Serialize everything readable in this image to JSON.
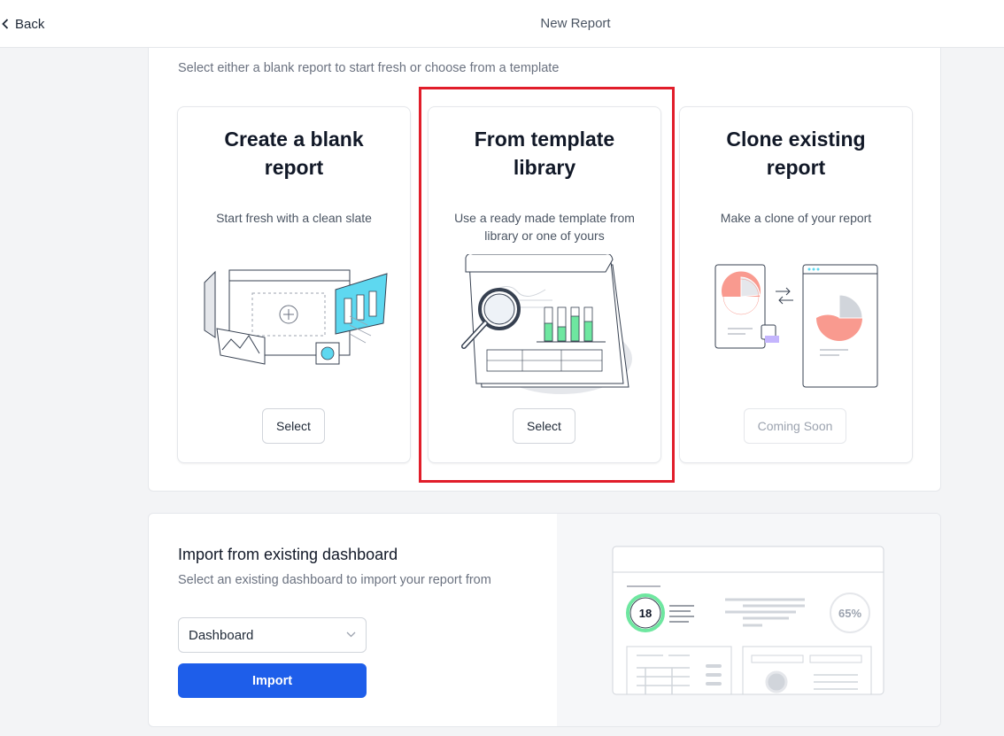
{
  "header": {
    "back_label": "Back",
    "title": "New Report"
  },
  "section": {
    "subtitle": "Select either a blank report to start fresh or choose from a template"
  },
  "cards": [
    {
      "title": "Create a blank report",
      "description": "Start fresh with a clean slate",
      "button": "Select"
    },
    {
      "title": "From template library",
      "description": "Use a ready made template from library or one of yours",
      "button": "Select"
    },
    {
      "title": "Clone existing report",
      "description": "Make a clone of your report",
      "button": "Coming Soon"
    }
  ],
  "import": {
    "title": "Import from existing dashboard",
    "subtitle": "Select an existing dashboard to import your report from",
    "dropdown_value": "Dashboard",
    "button": "Import",
    "preview_number": "18",
    "preview_percent": "65%"
  },
  "colors": {
    "accent": "#1e5eea",
    "highlight": "#e11d2a",
    "green": "#6ee7a0",
    "salmon": "#f99a8f",
    "cyan": "#5ed8f0"
  }
}
